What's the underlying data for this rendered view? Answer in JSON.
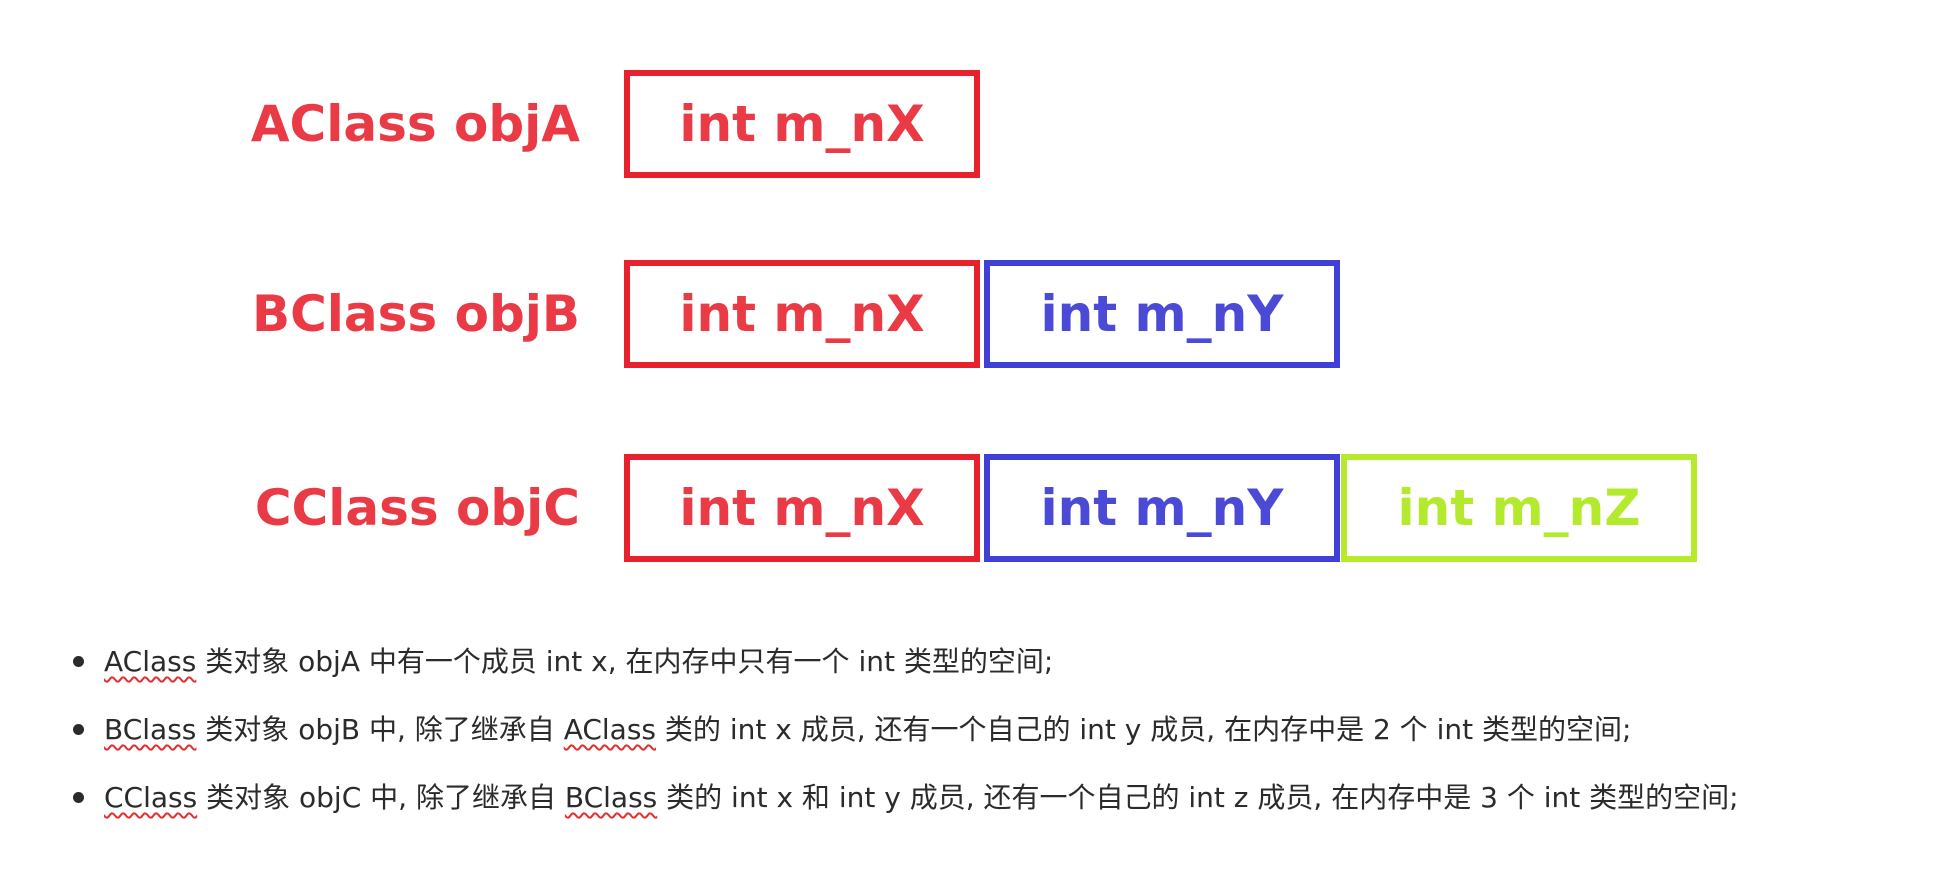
{
  "colors": {
    "class_a": "#e8222c",
    "class_b": "#4040d6",
    "class_c": "#b8ea2c",
    "label": "#ea3a45",
    "text": "#2b2b2b",
    "spellcheck": "#e03030"
  },
  "diagram": {
    "rows": [
      {
        "label": "AClass objA",
        "cells": [
          "int m_nX"
        ]
      },
      {
        "label": "BClass objB",
        "cells": [
          "int m_nX",
          "int m_nY"
        ]
      },
      {
        "label": "CClass objC",
        "cells": [
          "int m_nX",
          "int m_nY",
          "int m_nZ"
        ]
      }
    ]
  },
  "notes": [
    {
      "class_name": "AClass",
      "rest": " 类对象 objA 中有一个成员 int x, 在内存中只有一个 int 类型的空间;"
    },
    {
      "class_name": "BClass",
      "middle": " 类对象 objB 中, 除了继承自 ",
      "parent_name": "AClass",
      "rest": " 类的 int x 成员, 还有一个自己的 int y 成员, 在内存中是 2 个 int 类型的空间;"
    },
    {
      "class_name": "CClass",
      "middle": " 类对象 objC 中, 除了继承自 ",
      "parent_name": "BClass",
      "rest": " 类的 int x 和 int y 成员, 还有一个自己的 int z 成员, 在内存中是 3 个 int 类型的空间;"
    }
  ]
}
